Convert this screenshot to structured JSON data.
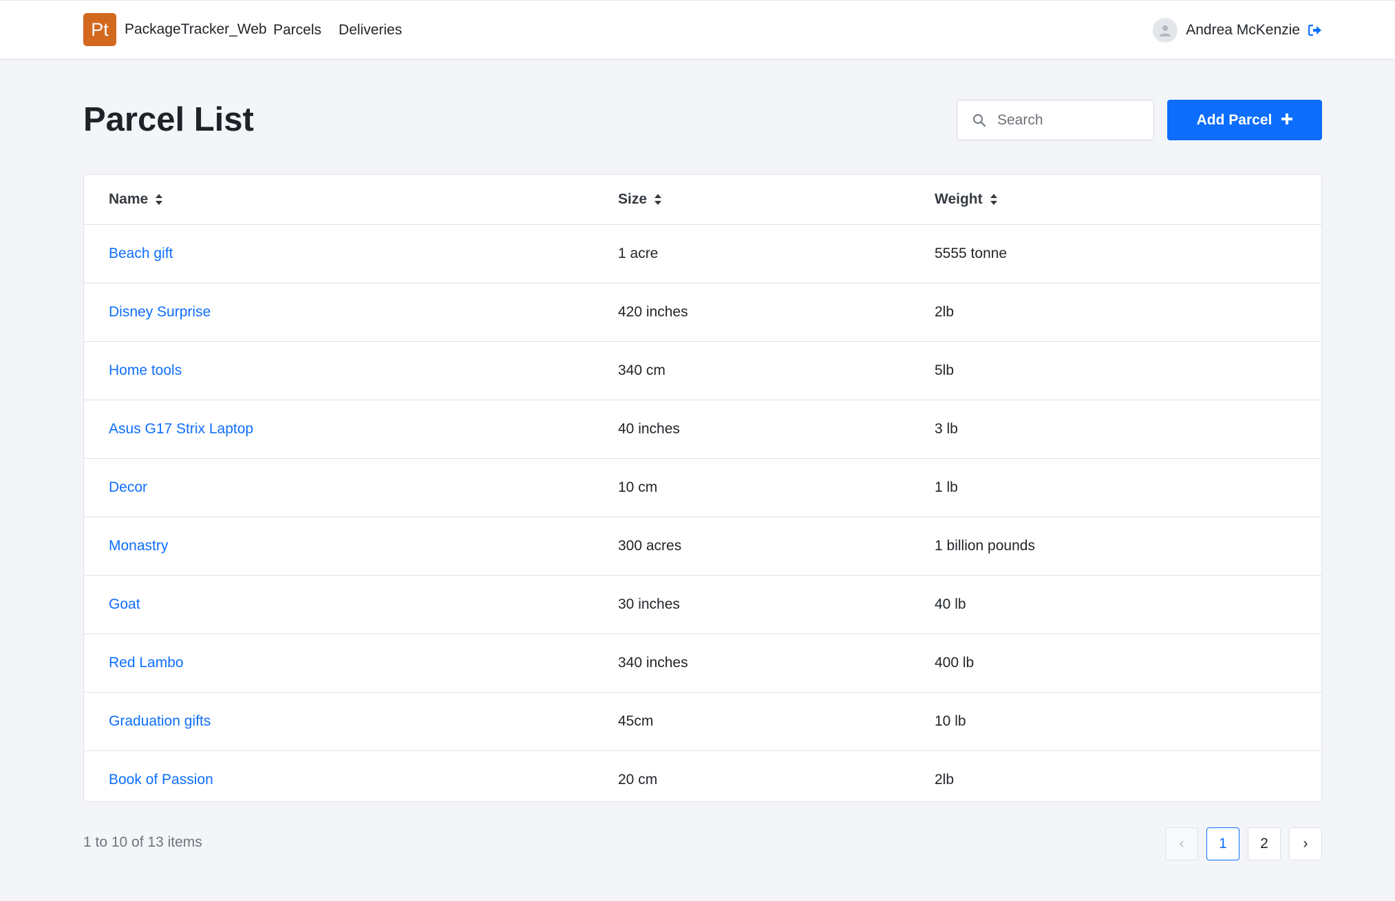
{
  "header": {
    "logo_text": "Pt",
    "app_name": "PackageTracker_Web",
    "nav": [
      {
        "label": "Parcels"
      },
      {
        "label": "Deliveries"
      }
    ],
    "user_name": "Andrea McKenzie"
  },
  "page": {
    "title": "Parcel List",
    "search_placeholder": "Search",
    "add_label": "Add Parcel"
  },
  "table": {
    "columns": [
      "Name",
      "Size",
      "Weight"
    ],
    "rows": [
      {
        "name": "Beach gift",
        "size": "1 acre",
        "weight": "5555 tonne"
      },
      {
        "name": "Disney Surprise",
        "size": "420 inches",
        "weight": "2lb"
      },
      {
        "name": "Home tools",
        "size": "340 cm",
        "weight": "5lb"
      },
      {
        "name": "Asus G17 Strix Laptop",
        "size": "40 inches",
        "weight": "3 lb"
      },
      {
        "name": "Decor",
        "size": "10 cm",
        "weight": "1 lb"
      },
      {
        "name": "Monastry",
        "size": "300 acres",
        "weight": "1 billion pounds"
      },
      {
        "name": "Goat",
        "size": "30 inches",
        "weight": "40 lb"
      },
      {
        "name": "Red Lambo",
        "size": "340 inches",
        "weight": "400 lb"
      },
      {
        "name": "Graduation gifts",
        "size": "45cm",
        "weight": "10 lb"
      },
      {
        "name": "Book of Passion",
        "size": "20 cm",
        "weight": "2lb"
      }
    ]
  },
  "footer": {
    "count_text": "1 to 10 of 13 items",
    "pages": [
      "1",
      "2"
    ],
    "prev_symbol": "‹",
    "next_symbol": "›"
  },
  "colors": {
    "brand_logo": "#d2691e",
    "primary": "#0d6efd",
    "background": "#f3f5f8"
  }
}
